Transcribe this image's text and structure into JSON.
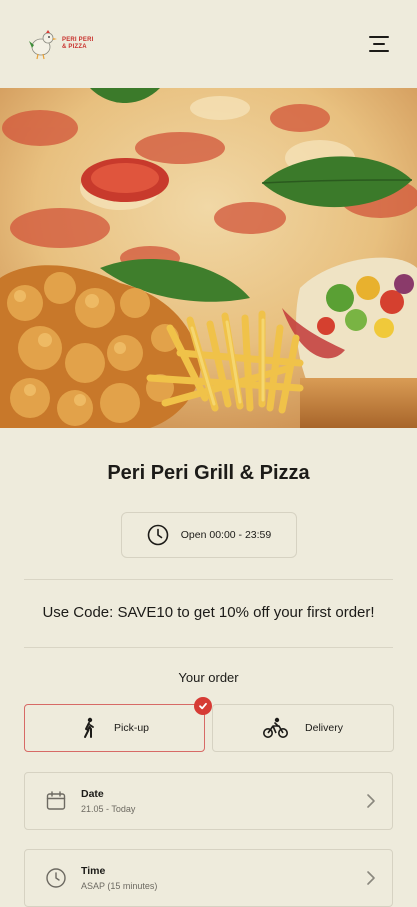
{
  "header": {
    "logo_line1": "Peri Peri",
    "logo_line2": "& Pizza"
  },
  "restaurant": {
    "name": "Peri Peri Grill & Pizza",
    "hours": "Open 00:00 - 23:59"
  },
  "promo": "Use Code: SAVE10 to get 10% off your first order!",
  "order": {
    "heading": "Your order",
    "pickup_label": "Pick-up",
    "delivery_label": "Delivery",
    "selected": "pickup"
  },
  "date": {
    "label": "Date",
    "value": "21.05 - Today"
  },
  "time": {
    "label": "Time",
    "value": "ASAP (15 minutes)"
  },
  "colors": {
    "accent": "#d63b35",
    "background": "#eeebdc"
  }
}
